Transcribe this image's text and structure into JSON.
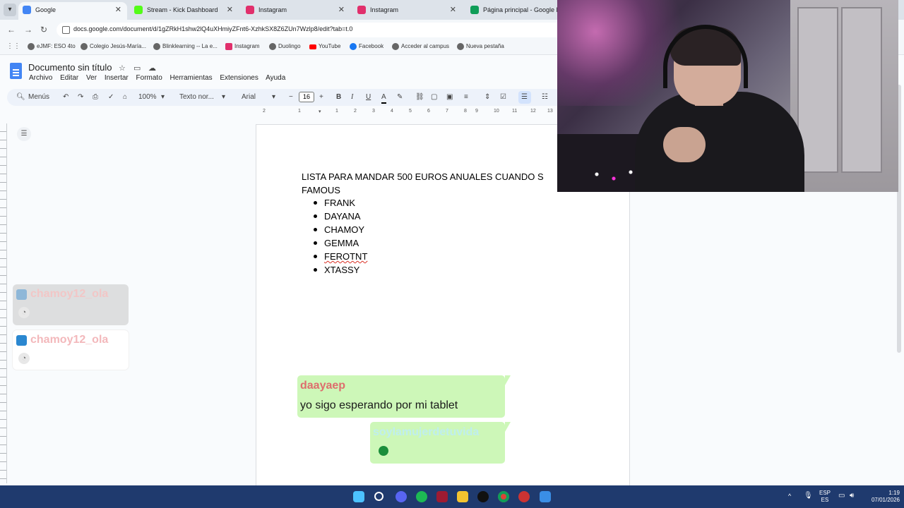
{
  "browser": {
    "tabs": [
      {
        "title": "Google",
        "color": "#4285f4"
      },
      {
        "title": "Stream - Kick Dashboard",
        "color": "#53fc18"
      },
      {
        "title": "Instagram",
        "color": "#e1306c"
      },
      {
        "title": "Instagram",
        "color": "#e1306c"
      },
      {
        "title": "Página principal - Google Drive",
        "color": "#0f9d58"
      }
    ],
    "url": "docs.google.com/document/d/1gZRkH1shw2lQ4uXHmiyZFnt6-XzhkSX8Z6ZUn7Wzlp8/edit?tab=t.0",
    "bookmarks": [
      {
        "label": "eJMF: ESO 4to",
        "color": "#666"
      },
      {
        "label": "Colegio Jesús-María...",
        "color": "#666"
      },
      {
        "label": "Blinklearning -- La e...",
        "color": "#666"
      },
      {
        "label": "Instagram",
        "color": "#e1306c"
      },
      {
        "label": "Duolingo",
        "color": "#666"
      },
      {
        "label": "YouTube",
        "color": "#ff0000"
      },
      {
        "label": "Facebook",
        "color": "#1877f2"
      },
      {
        "label": "Acceder al campus",
        "color": "#666"
      },
      {
        "label": "Nueva pestaña",
        "color": "#666"
      }
    ]
  },
  "docs": {
    "title": "Documento sin título",
    "menu": [
      "Archivo",
      "Editar",
      "Ver",
      "Insertar",
      "Formato",
      "Herramientas",
      "Extensiones",
      "Ayuda"
    ],
    "toolbar": {
      "menus": "Menús",
      "zoom": "100%",
      "style": "Texto nor...",
      "font": "Arial",
      "font_size": "16"
    },
    "ruler_ticks": [
      "2",
      "1",
      "1",
      "2",
      "3",
      "4",
      "5",
      "6",
      "7",
      "8",
      "9",
      "10",
      "11",
      "12",
      "13",
      "14"
    ],
    "heading": "LISTA PARA MANDAR 500 EUROS ANUALES CUANDO S FAMOUS",
    "list": [
      "FRANK",
      "DAYANA",
      "CHAMOY",
      "GEMMA",
      "FEROTNT",
      "XTASSY"
    ]
  },
  "chat_overlays": [
    {
      "user": "chamoy12_ola"
    },
    {
      "user": "chamoy12_ola"
    }
  ],
  "chat_bubbles": [
    {
      "user": "daayaep",
      "message": "yo sigo esperando por mi tablet"
    },
    {
      "user": "soylamujerdetuvida"
    }
  ],
  "taskbar": {
    "lang_top": "ESP",
    "lang_bottom": "ES",
    "time": "1:19",
    "date": "07/01/2026"
  }
}
